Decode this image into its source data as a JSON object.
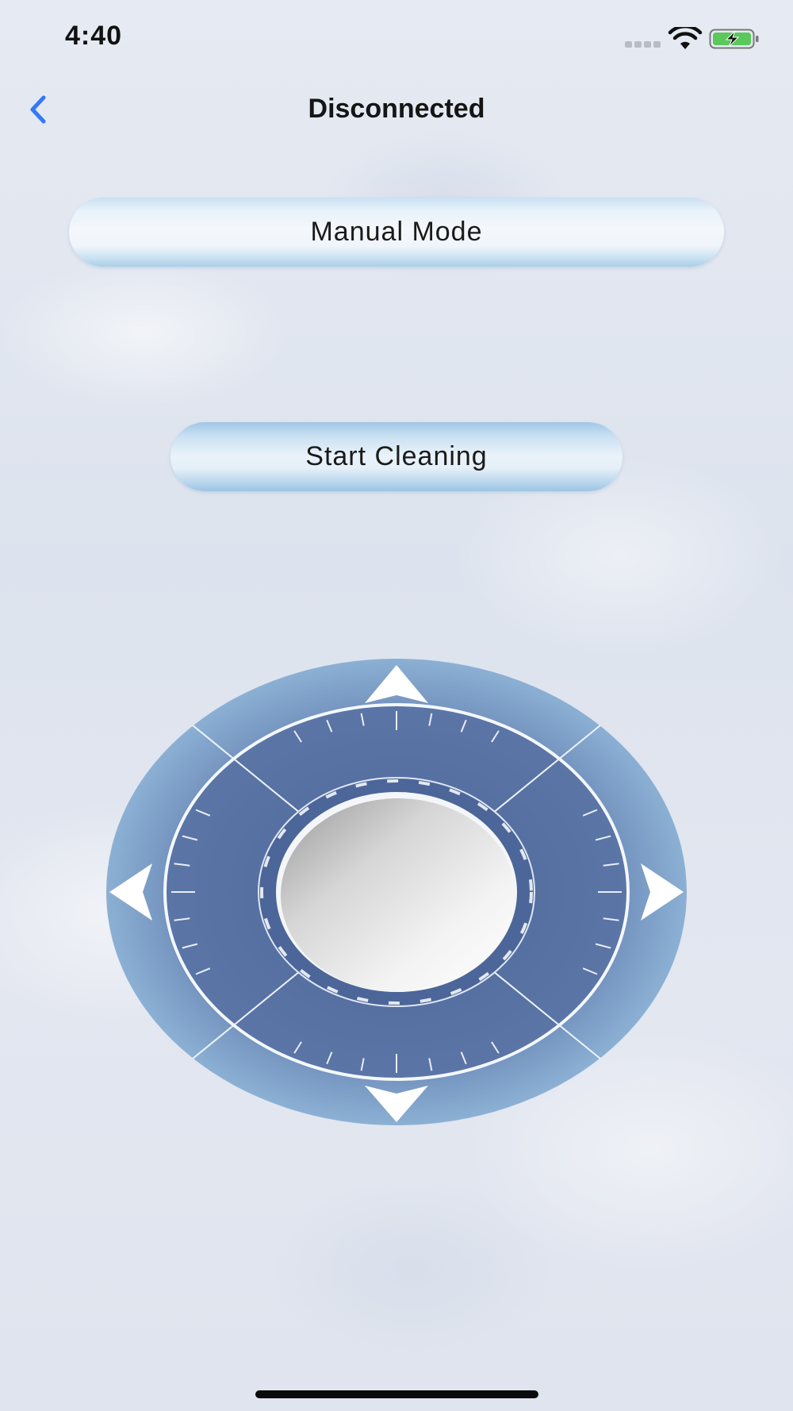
{
  "status_bar": {
    "time": "4:40",
    "icons": [
      "cellular-signal-icon",
      "wifi-icon",
      "battery-charging-icon"
    ],
    "battery_color": "#5ac85a"
  },
  "nav": {
    "back_icon": "chevron-left-icon",
    "title": "Disconnected",
    "accent_color": "#3478f6"
  },
  "controls": {
    "mode_label": "Manual Mode",
    "start_label": "Start Cleaning"
  },
  "joystick": {
    "icons": [
      "arrow-up-icon",
      "arrow-down-icon",
      "arrow-left-icon",
      "arrow-right-icon"
    ],
    "ring_color": "#5a74a3",
    "outer_color": "#7fa3c9",
    "center_color": "#e8e8e8"
  }
}
